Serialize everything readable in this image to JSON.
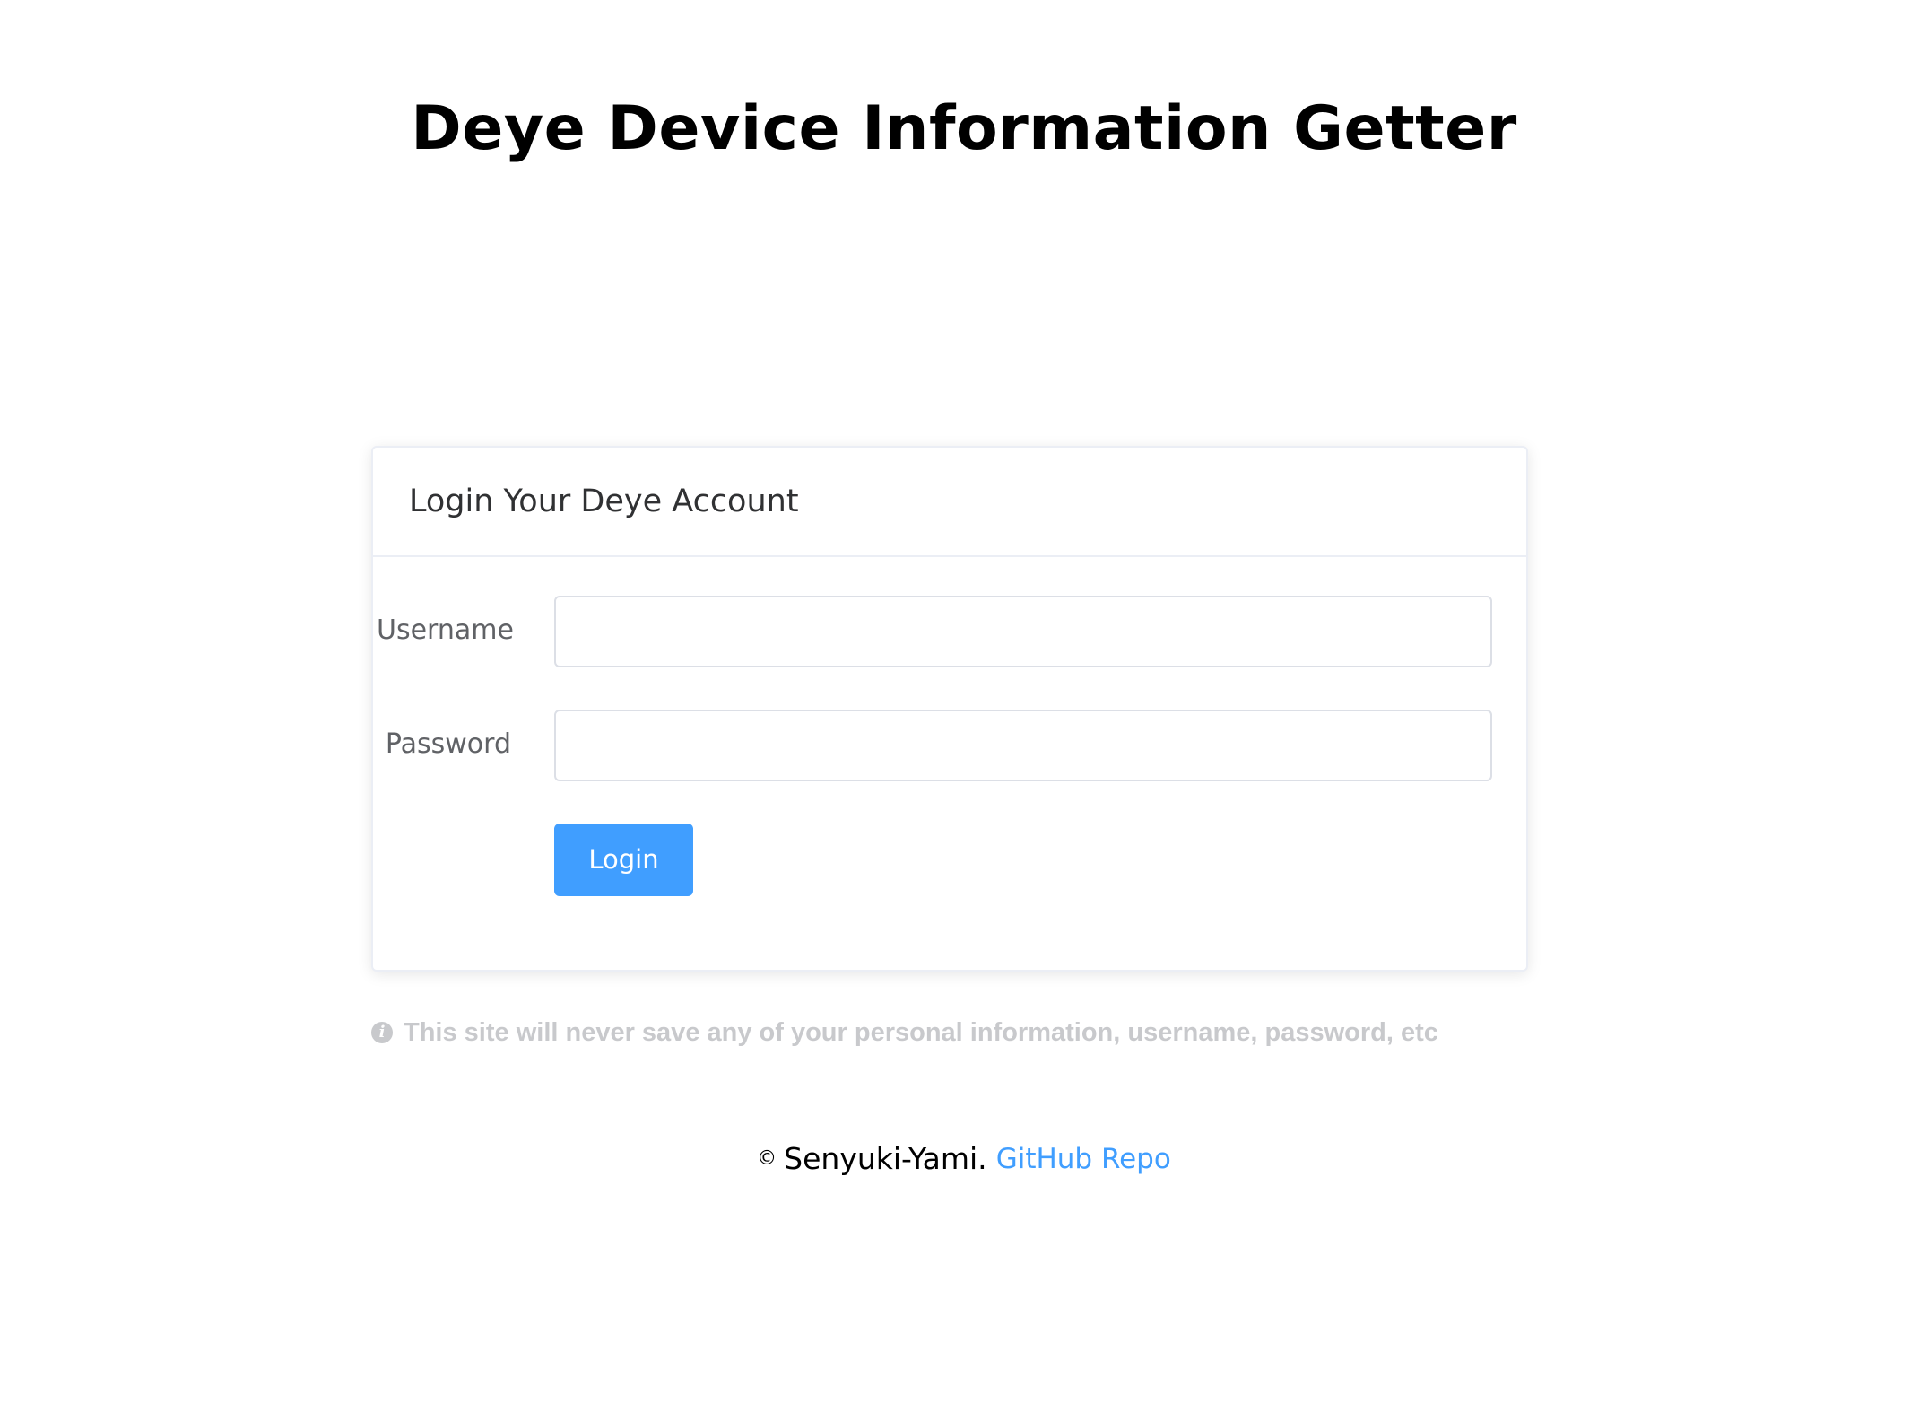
{
  "header": {
    "title": "Deye Device Information Getter"
  },
  "login_card": {
    "title": "Login Your Deye Account",
    "username_label": "Username",
    "username_value": "",
    "username_placeholder": "",
    "password_label": "Password",
    "password_value": "",
    "password_placeholder": "",
    "login_button_label": "Login"
  },
  "notice": {
    "icon": "info-icon",
    "text": "This site will never save any of your personal information, username, password, etc"
  },
  "footer": {
    "copyright_symbol": "©",
    "author": "Senyuki-Yami.",
    "repo_link_label": "GitHub Repo"
  },
  "colors": {
    "primary": "#409eff",
    "notice_text": "#c8c9cc",
    "border": "#dcdfe6"
  }
}
